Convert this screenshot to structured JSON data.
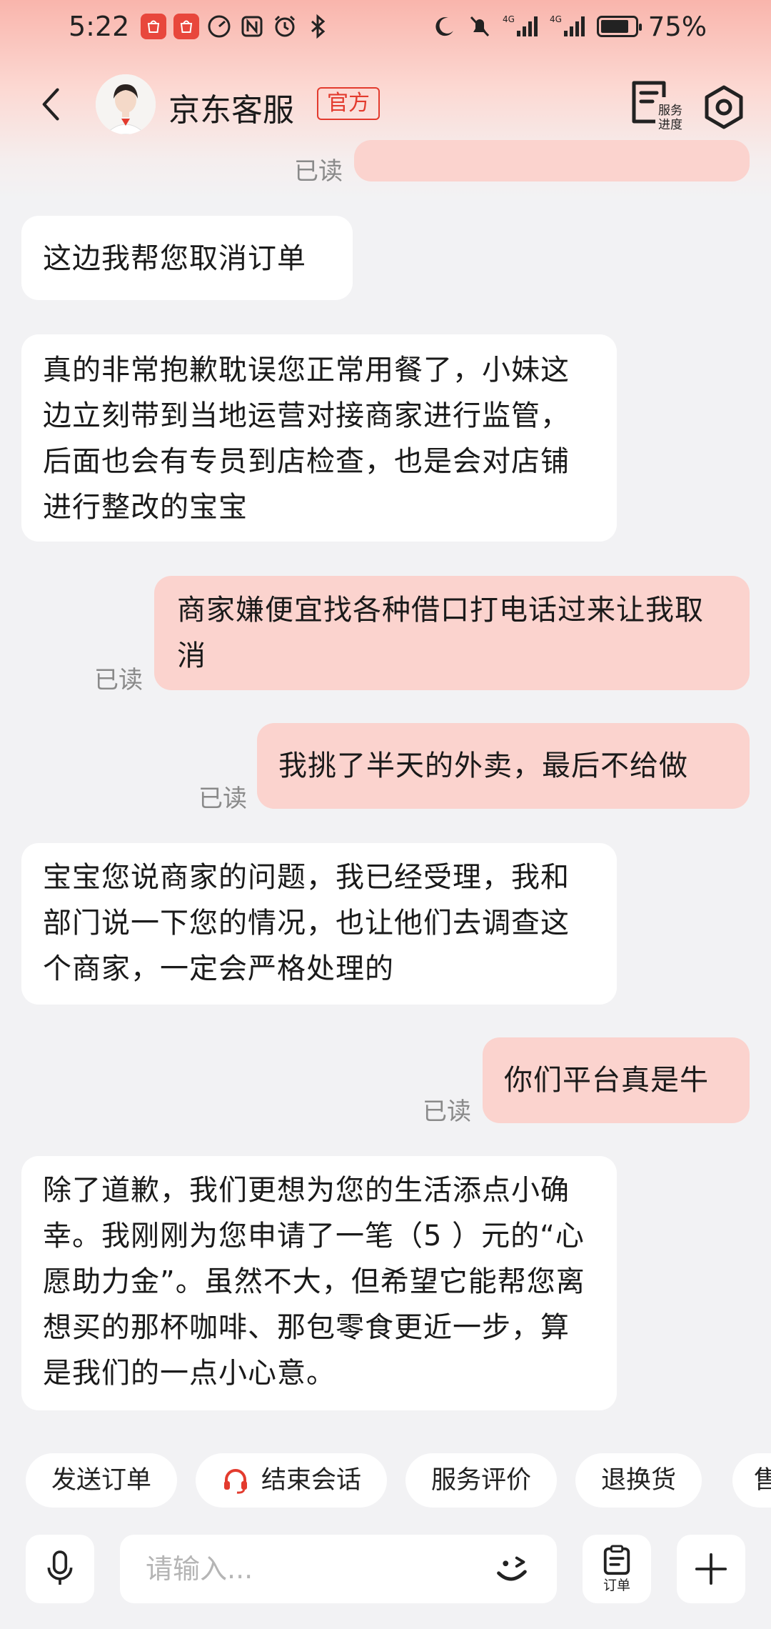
{
  "status_bar": {
    "time": "5:22",
    "battery_percent": "75%",
    "network_1": "4G",
    "network_2": "4G"
  },
  "header": {
    "title": "京东客服",
    "official_tag": "官方",
    "progress_label_1": "服务",
    "progress_label_2": "进度"
  },
  "messages": [
    {
      "side": "right",
      "text": "",
      "status": "已读"
    },
    {
      "side": "left",
      "text": "这边我帮您取消订单"
    },
    {
      "side": "left",
      "text": "真的非常抱歉耽误您正常用餐了，小妹这边立刻带到当地运营对接商家进行监管，后面也会有专员到店检查，也是会对店铺进行整改的宝宝"
    },
    {
      "side": "right",
      "text": "商家嫌便宜找各种借口打电话过来让我取消",
      "status": "已读"
    },
    {
      "side": "right",
      "text": "我挑了半天的外卖，最后不给做",
      "status": "已读"
    },
    {
      "side": "left",
      "text": "宝宝您说商家的问题，我已经受理，我和部门说一下您的情况，也让他们去调查这个商家，一定会严格处理的"
    },
    {
      "side": "right",
      "text": "你们平台真是牛",
      "status": "已读"
    },
    {
      "side": "left",
      "text": "除了道歉，我们更想为您的生活添点小确幸。我刚刚为您申请了一笔（5 ）元的“心愿助力金”。虽然不大，但希望它能帮您离想买的那杯咖啡、那包零食更近一步，算是我们的一点小心意。"
    }
  ],
  "quick_actions": [
    {
      "label": "发送订单"
    },
    {
      "label": "结束会话",
      "icon": "headset-icon"
    },
    {
      "label": "服务评价"
    },
    {
      "label": "退换货"
    },
    {
      "label": "售"
    }
  ],
  "input": {
    "placeholder": "请输入...",
    "order_label": "订单"
  },
  "colors": {
    "accent": "#e33b2e",
    "user_bubble": "#fbd3ce",
    "agent_bubble": "#ffffff",
    "background": "#f2f2f4"
  }
}
